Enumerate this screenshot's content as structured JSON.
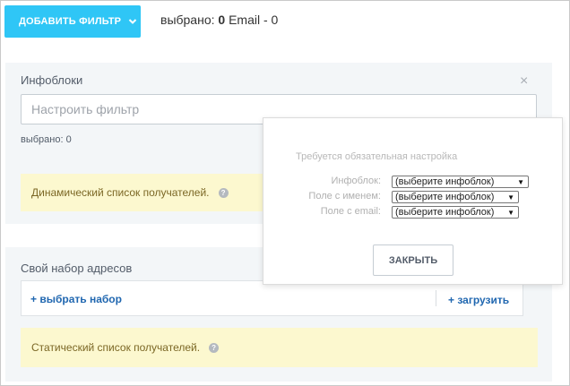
{
  "toolbar": {
    "add_filter_label": "ДОБАВИТЬ ФИЛЬТР",
    "selected_prefix": "выбрано:",
    "selected_count": "0",
    "email_label": "Email - 0"
  },
  "infoblocks": {
    "title": "Инфоблоки",
    "close_glyph": "×",
    "filter_placeholder": "Настроить фильтр",
    "selected_text": "выбрано:  0",
    "dynamic_note": "Динамический список получателей.",
    "help_glyph": "?"
  },
  "address_set": {
    "title": "Свой набор адресов",
    "choose_link": "+ выбрать набор",
    "upload_link": "+ загрузить",
    "static_note": "Статический список получателей.",
    "help_glyph": "?"
  },
  "popup": {
    "heading": "Требуется обязательная настройка",
    "rows": [
      {
        "label": "Инфоблок:",
        "value": "(выберите инфоблок)"
      },
      {
        "label": "Поле с именем:",
        "value": "(выберите инфоблок)"
      },
      {
        "label": "Поле с email:",
        "value": "(выберите инфоблок)"
      }
    ],
    "close_label": "ЗАКРЫТЬ",
    "arrow_glyph": "▼"
  },
  "colors": {
    "accent": "#2fc6f6",
    "panel_bg": "#f3f6f8",
    "note_bg": "#fcf8cf",
    "link": "#2067b0"
  }
}
